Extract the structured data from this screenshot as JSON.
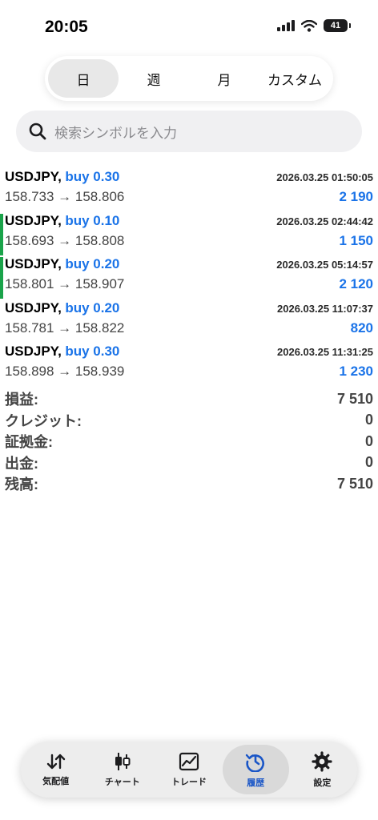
{
  "status": {
    "time": "20:05",
    "battery": "41"
  },
  "periods": [
    {
      "label": "日",
      "active": true
    },
    {
      "label": "週"
    },
    {
      "label": "月"
    },
    {
      "label": "カスタム"
    }
  ],
  "search": {
    "placeholder": "検索シンボルを入力"
  },
  "deals": [
    {
      "symbol": "USDJPY,",
      "side": "buy 0.30",
      "datetime": "2026.03.25 01:50:05",
      "prices": "158.733 → 158.806",
      "profit": "2 190"
    },
    {
      "symbol": "USDJPY,",
      "side": "buy 0.10",
      "datetime": "2026.03.25 02:44:42",
      "prices": "158.693 → 158.808",
      "profit": "1 150"
    },
    {
      "symbol": "USDJPY,",
      "side": "buy 0.20",
      "datetime": "2026.03.25 05:14:57",
      "prices": "158.801 → 158.907",
      "profit": "2 120"
    },
    {
      "symbol": "USDJPY,",
      "side": "buy 0.20",
      "datetime": "2026.03.25 11:07:37",
      "prices": "158.781 → 158.822",
      "profit": "820"
    },
    {
      "symbol": "USDJPY,",
      "side": "buy 0.30",
      "datetime": "2026.03.25 11:31:25",
      "prices": "158.898 → 158.939",
      "profit": "1 230"
    }
  ],
  "summary": [
    {
      "label": "損益:",
      "value": "7 510"
    },
    {
      "label": "クレジット:",
      "value": "0"
    },
    {
      "label": "証拠金:",
      "value": "0"
    },
    {
      "label": "出金:",
      "value": "0"
    },
    {
      "label": "残高:",
      "value": "7 510"
    }
  ],
  "tabs": [
    {
      "label": "気配値",
      "icon": "quotes-arrows-icon"
    },
    {
      "label": "チャート",
      "icon": "candlestick-icon"
    },
    {
      "label": "トレード",
      "icon": "trade-chart-icon"
    },
    {
      "label": "履歴",
      "icon": "history-clock-icon",
      "active": true
    },
    {
      "label": "設定",
      "icon": "gear-icon"
    }
  ],
  "colors": {
    "accent": "#1a73e8",
    "active_tab": "#1a56c7",
    "marker": "#1aa34a"
  }
}
